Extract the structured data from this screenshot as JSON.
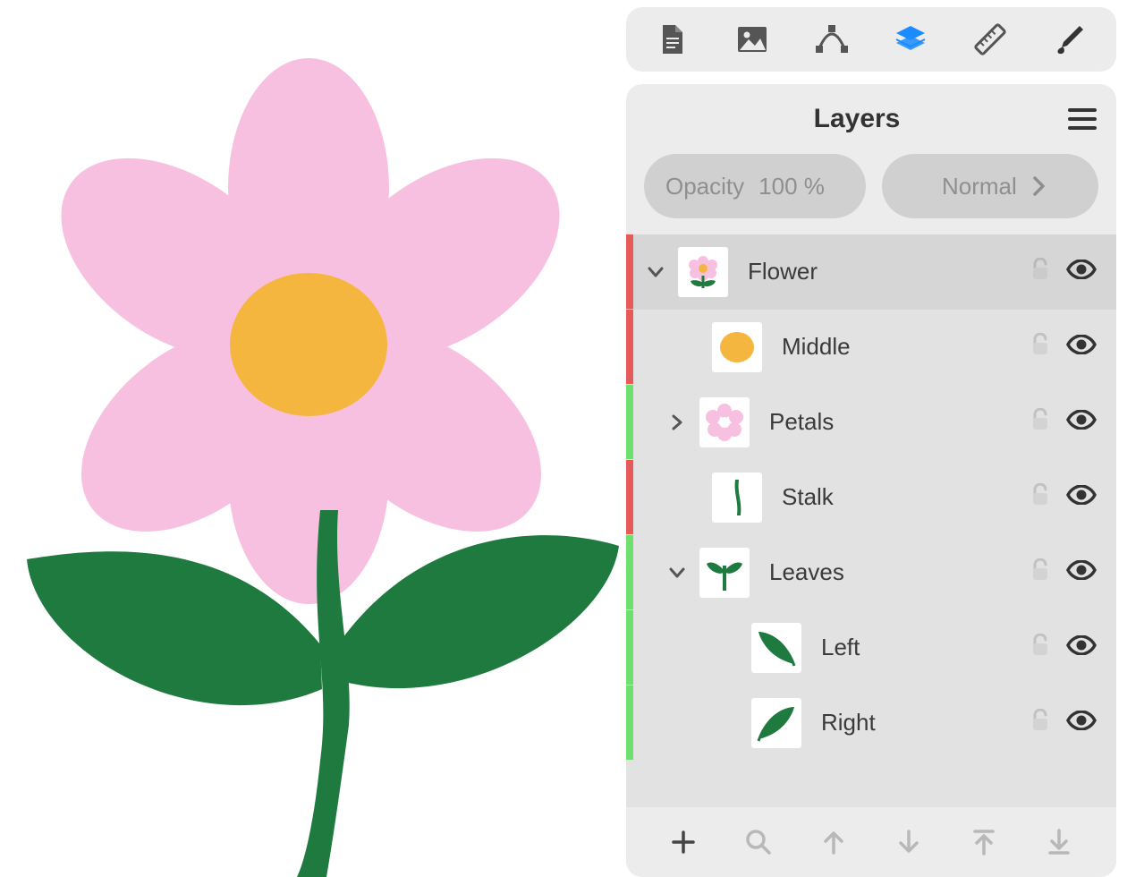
{
  "panel": {
    "title": "Layers",
    "opacity_label": "Opacity",
    "opacity_value": "100 %",
    "blend_mode": "Normal",
    "layers": [
      {
        "name": "Flower",
        "indent": 0,
        "disclosure": "open",
        "bar": "#e85a5a"
      },
      {
        "name": "Middle",
        "indent": 1,
        "disclosure": "none",
        "bar": "#e85a5a"
      },
      {
        "name": "Petals",
        "indent": 1,
        "disclosure": "closed",
        "bar": "#6de06d"
      },
      {
        "name": "Stalk",
        "indent": 1,
        "disclosure": "none",
        "bar": "#e85a5a"
      },
      {
        "name": "Leaves",
        "indent": 1,
        "disclosure": "open",
        "bar": "#6de06d"
      },
      {
        "name": "Left",
        "indent": 2,
        "disclosure": "none",
        "bar": "#6de06d"
      },
      {
        "name": "Right",
        "indent": 2,
        "disclosure": "none",
        "bar": "#6de06d"
      }
    ]
  },
  "colors": {
    "petal": "#f8c0e0",
    "center": "#f4b63e",
    "leaf": "#1e7a3e"
  },
  "toolbar_icons": [
    "document",
    "image",
    "vector",
    "layers-active",
    "ruler",
    "brush"
  ]
}
